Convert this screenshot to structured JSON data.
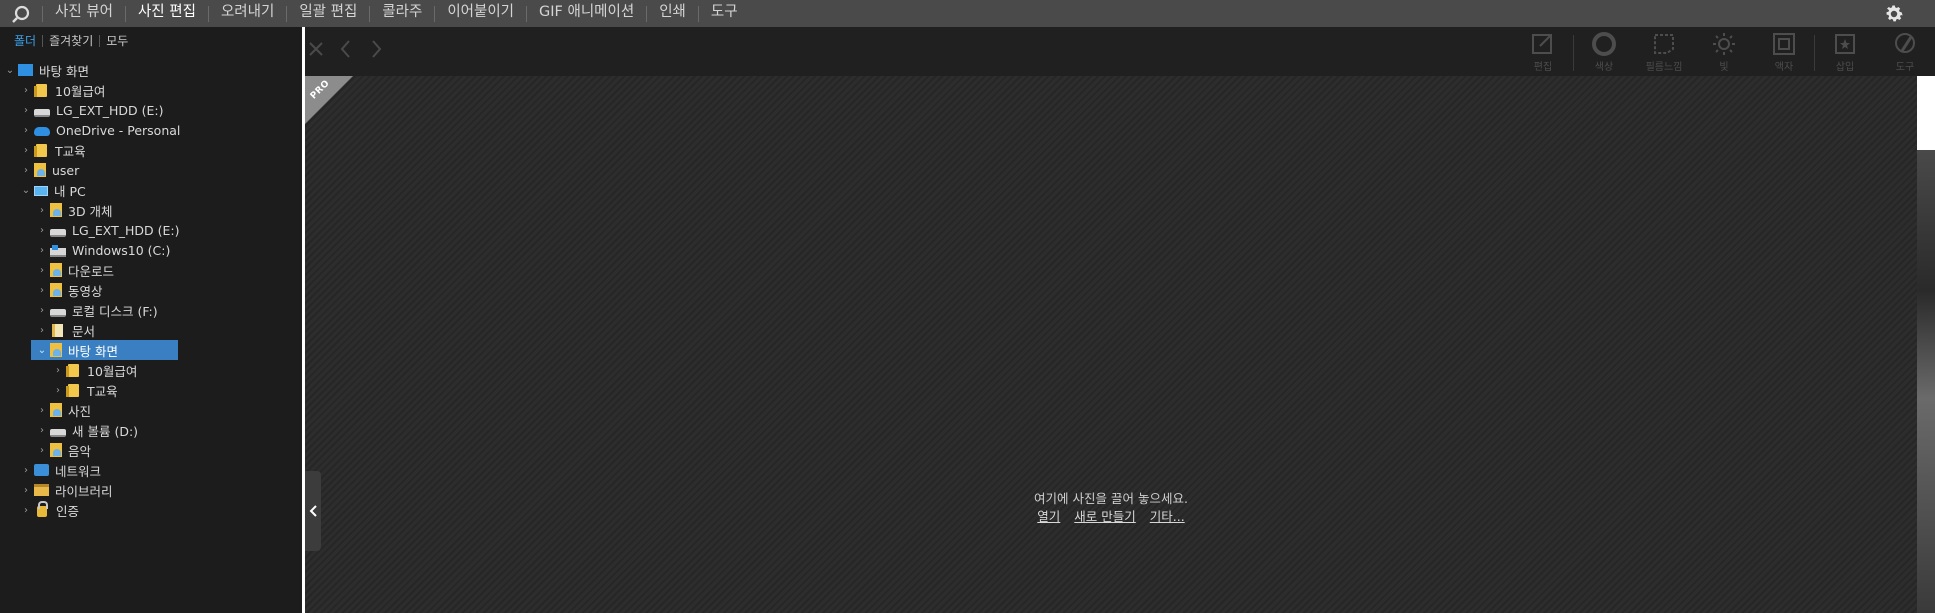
{
  "menu": {
    "items": [
      {
        "label": "사진 뷰어",
        "active": false
      },
      {
        "label": "사진 편집",
        "active": true
      },
      {
        "label": "오려내기",
        "active": false
      },
      {
        "label": "일괄 편집",
        "active": false
      },
      {
        "label": "콜라주",
        "active": false
      },
      {
        "label": "이어붙이기",
        "active": false
      },
      {
        "label": "GIF 애니메이션",
        "active": false
      },
      {
        "label": "인쇄",
        "active": false
      },
      {
        "label": "도구",
        "active": false
      }
    ]
  },
  "left_panel": {
    "tabs": [
      {
        "label": "폴더",
        "active": true
      },
      {
        "label": "즐겨찾기",
        "active": false
      },
      {
        "label": "모두",
        "active": false
      }
    ],
    "tree": [
      {
        "label": "바탕 화면",
        "depth": 0,
        "expanded": true,
        "icon": "desktop-icon"
      },
      {
        "label": "10월급여",
        "depth": 1,
        "icon": "folder-icon"
      },
      {
        "label": "LG_EXT_HDD (E:)",
        "depth": 1,
        "icon": "drive-icon"
      },
      {
        "label": "OneDrive - Personal",
        "depth": 1,
        "icon": "cloud-icon"
      },
      {
        "label": "T교육",
        "depth": 1,
        "icon": "folder-icon"
      },
      {
        "label": "user",
        "depth": 1,
        "icon": "user-folder-icon"
      },
      {
        "label": "내 PC",
        "depth": 1,
        "expanded": true,
        "icon": "pc-icon"
      },
      {
        "label": "3D 개체",
        "depth": 2,
        "icon": "3d-objects-icon"
      },
      {
        "label": "LG_EXT_HDD (E:)",
        "depth": 2,
        "icon": "drive-icon"
      },
      {
        "label": "Windows10 (C:)",
        "depth": 2,
        "icon": "windows-drive-icon"
      },
      {
        "label": "다운로드",
        "depth": 2,
        "icon": "downloads-icon"
      },
      {
        "label": "동영상",
        "depth": 2,
        "icon": "videos-icon"
      },
      {
        "label": "로컬 디스크 (F:)",
        "depth": 2,
        "icon": "drive-icon"
      },
      {
        "label": "문서",
        "depth": 2,
        "icon": "documents-icon"
      },
      {
        "label": "바탕 화면",
        "depth": 2,
        "expanded": true,
        "selected": true,
        "icon": "desktop-folder-icon"
      },
      {
        "label": "10월급여",
        "depth": 3,
        "icon": "folder-icon"
      },
      {
        "label": "T교육",
        "depth": 3,
        "icon": "folder-icon"
      },
      {
        "label": "사진",
        "depth": 2,
        "icon": "pictures-icon"
      },
      {
        "label": "새 볼륨 (D:)",
        "depth": 2,
        "icon": "drive-icon"
      },
      {
        "label": "음악",
        "depth": 2,
        "icon": "music-icon"
      },
      {
        "label": "네트워크",
        "depth": 1,
        "icon": "network-icon"
      },
      {
        "label": "라이브러리",
        "depth": 1,
        "icon": "library-icon"
      },
      {
        "label": "인증",
        "depth": 1,
        "icon": "lock-icon"
      }
    ]
  },
  "toolbar": {
    "tools": [
      {
        "label": "편집",
        "icon": "edit-icon"
      },
      {
        "label": "색상",
        "icon": "color-icon"
      },
      {
        "label": "필름느낌",
        "icon": "film-icon"
      },
      {
        "label": "빛",
        "icon": "light-icon"
      },
      {
        "label": "액자",
        "icon": "frame-icon"
      },
      {
        "label": "삽입",
        "icon": "insert-icon"
      },
      {
        "label": "도구",
        "icon": "tools-icon"
      }
    ]
  },
  "canvas": {
    "badge_text": "PRO",
    "message": "여기에 사진을 끌어 놓으세요.",
    "links": {
      "open": "열기",
      "new": "새로 만들기",
      "more": "기타..."
    }
  }
}
